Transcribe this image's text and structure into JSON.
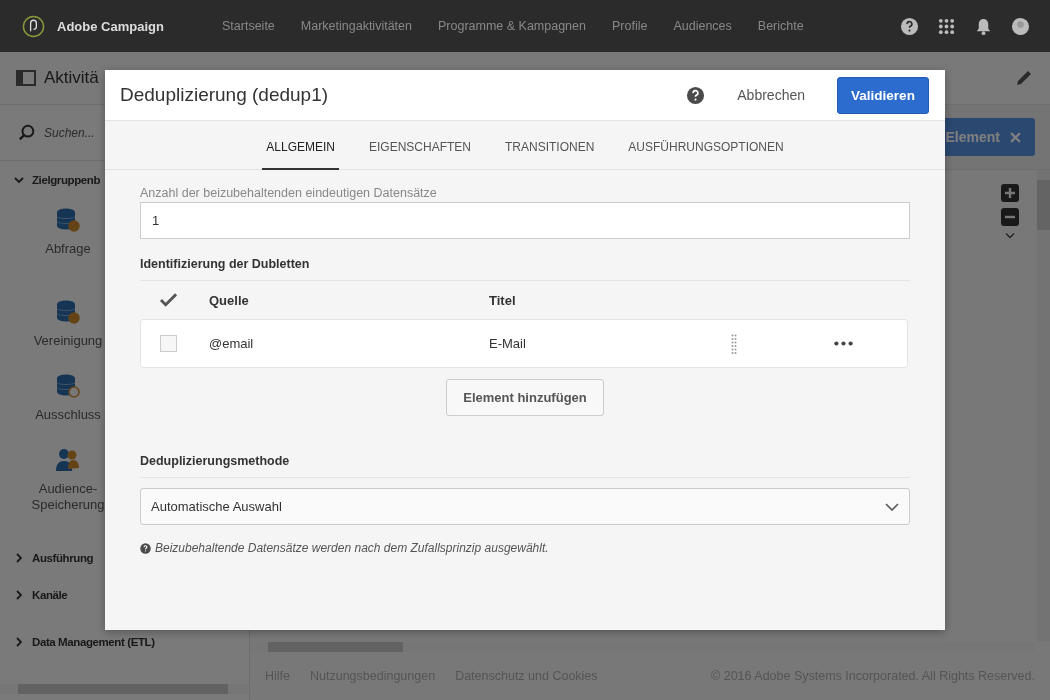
{
  "app": {
    "name": "Adobe Campaign"
  },
  "nav": [
    "Startseite",
    "Marketingaktivitäten",
    "Programme & Kampagnen",
    "Profile",
    "Audiences",
    "Berichte"
  ],
  "page_title": "Aktivitä",
  "sidebar": {
    "search_placeholder": "Suchen...",
    "groups": [
      {
        "label": "Zielgruppenb",
        "expanded": true,
        "children": [
          {
            "label": "Abfrage",
            "kind": "query"
          },
          {
            "label": "Vereinigung",
            "kind": "union"
          },
          {
            "label": "Ausschluss",
            "kind": "exclusion"
          },
          {
            "label": "Audience-Speicherung",
            "kind": "audience"
          }
        ]
      },
      {
        "label": "Ausführung",
        "expanded": false
      },
      {
        "label": "Kanäle",
        "expanded": false
      },
      {
        "label": "Data Management (ETL)",
        "expanded": false
      }
    ]
  },
  "element_button": "Element",
  "dialog": {
    "title": "Deduplizierung (dedup1)",
    "cancel": "Abbrechen",
    "validate": "Validieren",
    "tabs": [
      {
        "label": "ALLGEMEIN",
        "selected": true
      },
      {
        "label": "EIGENSCHAFTEN",
        "selected": false
      },
      {
        "label": "TRANSITIONEN",
        "selected": false
      },
      {
        "label": "AUSFÜHRUNGSOPTIONEN",
        "selected": false
      }
    ],
    "count_field": {
      "label": "Anzahl der beizubehaltenden eindeutigen Datensätze",
      "value": "1"
    },
    "duplicates": {
      "heading": "Identifizierung der Dubletten",
      "columns": [
        "Quelle",
        "Titel"
      ],
      "rows": [
        {
          "checked": false,
          "source": "@email",
          "title": "E-Mail"
        }
      ],
      "add_button": "Element hinzufügen"
    },
    "method": {
      "heading": "Deduplizierungsmethode",
      "value": "Automatische Auswahl",
      "note": "Beizubehaltende Datensätze werden nach dem Zufallsprinzip ausgewählt."
    }
  },
  "footer": {
    "links": [
      "Hilfe",
      "Nutzungsbedingungen",
      "Datenschutz und Cookies"
    ],
    "copyright": "© 2016 Adobe Systems Incorporated. All Rights Reserved."
  }
}
